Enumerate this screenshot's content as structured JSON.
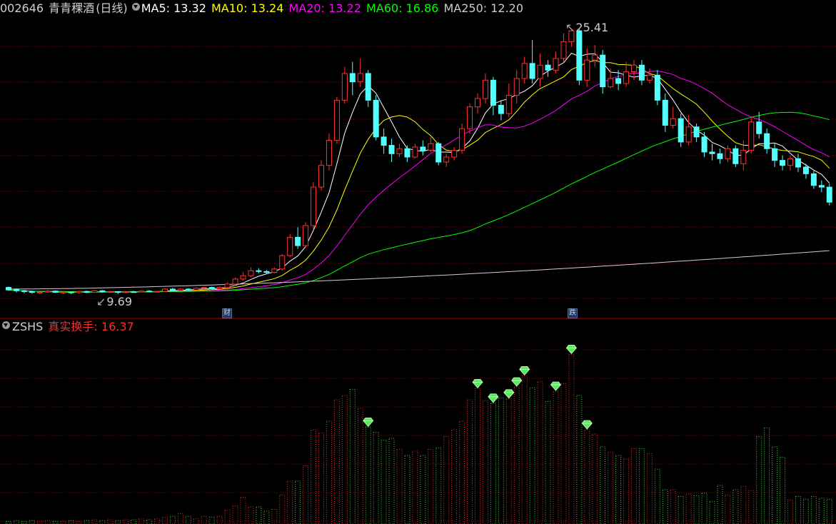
{
  "header": {
    "code": "002646",
    "name": "青青稞酒",
    "period": "(日线)",
    "ma": [
      {
        "label": "MA5: 13.32",
        "color": "#ffffff"
      },
      {
        "label": "MA10: 13.24",
        "color": "#ffff00"
      },
      {
        "label": "MA20: 13.22",
        "color": "#ff00ff"
      },
      {
        "label": "MA60: 16.86",
        "color": "#00ff00"
      },
      {
        "label": "MA250: 12.20",
        "color": "#cccccc"
      }
    ]
  },
  "indicator": {
    "name": "ZSHS",
    "label": "真实换手: 16.37",
    "label_color": "#ff2a2a"
  },
  "annotations": {
    "high": "25.41",
    "low": "9.69",
    "event1": "财",
    "event2": "跌"
  },
  "colors": {
    "up": "#ff3232",
    "down": "#54ffff",
    "grid": "#8b0000",
    "divider": "#b00000"
  },
  "chart_data": [
    {
      "type": "candlestick",
      "title": "002646 青青稞酒 (日线)",
      "ylim": [
        9.0,
        26.0
      ],
      "log_scale": false,
      "y_ticks_shown": false,
      "candles": [
        [
          10.0,
          9.85,
          10.05,
          9.8
        ],
        [
          9.9,
          9.8,
          9.95,
          9.7
        ],
        [
          9.8,
          9.75,
          9.85,
          9.65
        ],
        [
          9.75,
          9.7,
          9.8,
          9.62
        ],
        [
          9.7,
          9.72,
          9.78,
          9.6
        ],
        [
          9.72,
          9.78,
          9.85,
          9.68
        ],
        [
          9.78,
          9.7,
          9.82,
          9.66
        ],
        [
          9.7,
          9.72,
          9.76,
          9.6
        ],
        [
          9.72,
          9.69,
          9.74,
          9.6
        ],
        [
          9.69,
          9.76,
          9.8,
          9.62
        ],
        [
          9.76,
          9.7,
          9.8,
          9.65
        ],
        [
          9.7,
          9.8,
          9.86,
          9.68
        ],
        [
          9.8,
          9.72,
          9.84,
          9.68
        ],
        [
          9.72,
          9.75,
          9.8,
          9.68
        ],
        [
          9.75,
          9.7,
          9.78,
          9.6
        ],
        [
          9.7,
          9.74,
          9.78,
          9.66
        ],
        [
          9.74,
          9.72,
          9.8,
          9.7
        ],
        [
          9.72,
          9.78,
          9.82,
          9.7
        ],
        [
          9.78,
          9.74,
          9.85,
          9.72
        ],
        [
          9.74,
          9.76,
          9.8,
          9.7
        ],
        [
          9.76,
          9.9,
          9.95,
          9.74
        ],
        [
          9.9,
          9.82,
          9.98,
          9.78
        ],
        [
          9.82,
          9.9,
          9.96,
          9.8
        ],
        [
          9.9,
          9.85,
          9.95,
          9.82
        ],
        [
          9.85,
          9.95,
          10.0,
          9.82
        ],
        [
          9.95,
          10.0,
          10.05,
          9.9
        ],
        [
          10.0,
          9.92,
          10.05,
          9.88
        ],
        [
          9.92,
          10.0,
          10.06,
          9.9
        ],
        [
          10.0,
          10.2,
          10.3,
          9.95
        ],
        [
          10.2,
          10.5,
          10.6,
          10.1
        ],
        [
          10.5,
          10.7,
          10.9,
          10.4
        ],
        [
          10.7,
          11.0,
          11.2,
          10.6
        ],
        [
          11.0,
          10.95,
          11.15,
          10.85
        ],
        [
          10.95,
          10.9,
          11.05,
          10.8
        ],
        [
          10.9,
          11.1,
          11.2,
          10.85
        ],
        [
          11.1,
          11.9,
          12.0,
          11.0
        ],
        [
          11.9,
          13.0,
          13.2,
          11.8
        ],
        [
          13.0,
          12.5,
          13.6,
          12.3
        ],
        [
          12.5,
          13.7,
          13.9,
          12.4
        ],
        [
          13.7,
          16.0,
          16.3,
          13.5
        ],
        [
          16.0,
          17.3,
          17.6,
          15.8
        ],
        [
          17.3,
          18.8,
          19.2,
          17.0
        ],
        [
          18.8,
          21.2,
          21.4,
          18.6
        ],
        [
          21.2,
          22.8,
          23.2,
          21.0
        ],
        [
          22.8,
          22.3,
          23.5,
          21.5
        ],
        [
          22.3,
          22.8,
          23.7,
          22.0
        ],
        [
          22.8,
          21.2,
          23.0,
          20.8
        ],
        [
          21.2,
          19.0,
          21.5,
          18.8
        ],
        [
          19.0,
          18.5,
          19.5,
          18.0
        ],
        [
          18.5,
          18.0,
          18.9,
          17.5
        ],
        [
          18.0,
          18.3,
          18.6,
          17.8
        ],
        [
          18.3,
          17.8,
          18.5,
          17.5
        ],
        [
          17.8,
          18.4,
          18.6,
          17.7
        ],
        [
          18.4,
          18.2,
          18.8,
          17.9
        ],
        [
          18.2,
          18.6,
          19.0,
          18.1
        ],
        [
          18.6,
          17.5,
          18.7,
          17.3
        ],
        [
          17.5,
          17.8,
          18.0,
          17.2
        ],
        [
          17.8,
          18.2,
          18.4,
          17.6
        ],
        [
          18.2,
          19.5,
          19.8,
          18.0
        ],
        [
          19.5,
          20.8,
          21.0,
          19.2
        ],
        [
          20.8,
          21.3,
          21.6,
          20.4
        ],
        [
          21.3,
          22.4,
          22.8,
          21.0
        ],
        [
          22.4,
          20.9,
          22.6,
          20.3
        ],
        [
          20.9,
          20.4,
          21.2,
          20.0
        ],
        [
          20.4,
          21.5,
          22.2,
          20.2
        ],
        [
          21.5,
          22.5,
          23.0,
          21.0
        ],
        [
          22.5,
          23.4,
          23.8,
          22.2
        ],
        [
          23.4,
          22.5,
          24.8,
          22.2
        ],
        [
          22.5,
          23.3,
          24.0,
          22.0
        ],
        [
          23.3,
          23.0,
          23.6,
          22.6
        ],
        [
          23.0,
          23.7,
          24.1,
          22.8
        ],
        [
          23.7,
          24.7,
          25.2,
          23.5
        ],
        [
          24.7,
          25.35,
          25.41,
          24.4
        ],
        [
          25.35,
          22.4,
          25.5,
          22.1
        ],
        [
          22.4,
          23.6,
          24.3,
          22.0
        ],
        [
          23.6,
          23.9,
          24.5,
          23.2
        ],
        [
          23.9,
          22.0,
          24.2,
          21.6
        ],
        [
          22.0,
          22.5,
          23.1,
          21.9
        ],
        [
          22.5,
          22.2,
          23.0,
          21.8
        ],
        [
          22.2,
          22.9,
          23.5,
          22.0
        ],
        [
          22.9,
          23.3,
          23.6,
          22.4
        ],
        [
          23.3,
          22.4,
          23.6,
          22.1
        ],
        [
          22.4,
          22.7,
          23.1,
          22.2
        ],
        [
          22.7,
          21.2,
          23.0,
          20.9
        ],
        [
          21.2,
          19.7,
          21.6,
          19.3
        ],
        [
          19.7,
          20.1,
          20.8,
          19.5
        ],
        [
          20.1,
          18.7,
          20.4,
          18.4
        ],
        [
          18.7,
          19.6,
          20.3,
          18.5
        ],
        [
          19.6,
          19.0,
          19.8,
          18.7
        ],
        [
          19.0,
          18.1,
          19.3,
          17.8
        ],
        [
          18.1,
          18.0,
          18.6,
          17.6
        ],
        [
          18.0,
          17.7,
          18.3,
          17.4
        ],
        [
          17.7,
          18.3,
          18.5,
          17.5
        ],
        [
          18.3,
          17.4,
          18.5,
          17.2
        ],
        [
          17.4,
          18.2,
          18.8,
          17.0
        ],
        [
          18.2,
          19.9,
          20.2,
          18.0
        ],
        [
          19.9,
          19.2,
          20.5,
          18.9
        ],
        [
          19.2,
          18.3,
          19.5,
          18.0
        ],
        [
          18.3,
          17.6,
          18.6,
          17.2
        ],
        [
          17.6,
          17.3,
          17.9,
          17.0
        ],
        [
          17.3,
          17.7,
          17.9,
          17.0
        ],
        [
          17.7,
          17.2,
          18.0,
          16.9
        ],
        [
          17.2,
          16.8,
          17.4,
          16.5
        ],
        [
          16.8,
          16.1,
          17.0,
          15.9
        ],
        [
          16.1,
          16.0,
          16.4,
          15.7
        ],
        [
          16.0,
          15.1,
          16.2,
          14.9
        ]
      ],
      "moving_averages": [
        {
          "name": "MA5",
          "value": 13.32
        },
        {
          "name": "MA10",
          "value": 13.24
        },
        {
          "name": "MA20",
          "value": 13.22
        },
        {
          "name": "MA60",
          "value": 16.86
        },
        {
          "name": "MA250",
          "value": 12.2
        }
      ],
      "annotations": [
        {
          "text": "25.41",
          "at_bar": 72
        },
        {
          "text": "9.69",
          "at_bar": 8
        },
        {
          "text": "财",
          "at_bar": 26
        },
        {
          "text": "跌",
          "at_bar": 66
        }
      ]
    },
    {
      "type": "bar",
      "title": "ZSHS 真实换手: 16.37",
      "ylim": [
        0,
        22
      ],
      "values": [
        0.3,
        0.4,
        0.3,
        0.4,
        0.3,
        0.4,
        0.3,
        0.3,
        0.4,
        0.3,
        0.4,
        0.5,
        0.4,
        0.5,
        0.4,
        0.5,
        0.5,
        0.6,
        0.5,
        0.6,
        0.8,
        0.9,
        1.2,
        0.9,
        0.6,
        0.9,
        0.8,
        0.9,
        1.6,
        2.1,
        3.1,
        2.0,
        2.0,
        1.5,
        1.7,
        3.4,
        5.0,
        5.0,
        6.8,
        11.0,
        10.6,
        12.0,
        14.5,
        15.0,
        15.7,
        13.5,
        11.3,
        10.7,
        9.8,
        10.0,
        8.7,
        8.0,
        8.5,
        8.0,
        8.7,
        8.9,
        10.2,
        11.0,
        12.0,
        14.5,
        15.8,
        14.4,
        14.1,
        14.7,
        14.6,
        16.0,
        17.3,
        15.9,
        16.6,
        14.3,
        15.5,
        16.4,
        19.8,
        15.0,
        11.0,
        10.5,
        9.0,
        8.4,
        8.0,
        7.6,
        8.8,
        8.8,
        8.2,
        6.4,
        4.0,
        4.0,
        3.2,
        3.5,
        3.3,
        3.6,
        2.6,
        4.5,
        3.4,
        4.0,
        4.4,
        3.9,
        10.2,
        11.2,
        9.0,
        7.8,
        2.8,
        3.2,
        2.9,
        3.2,
        3.0,
        2.9
      ]
    }
  ]
}
